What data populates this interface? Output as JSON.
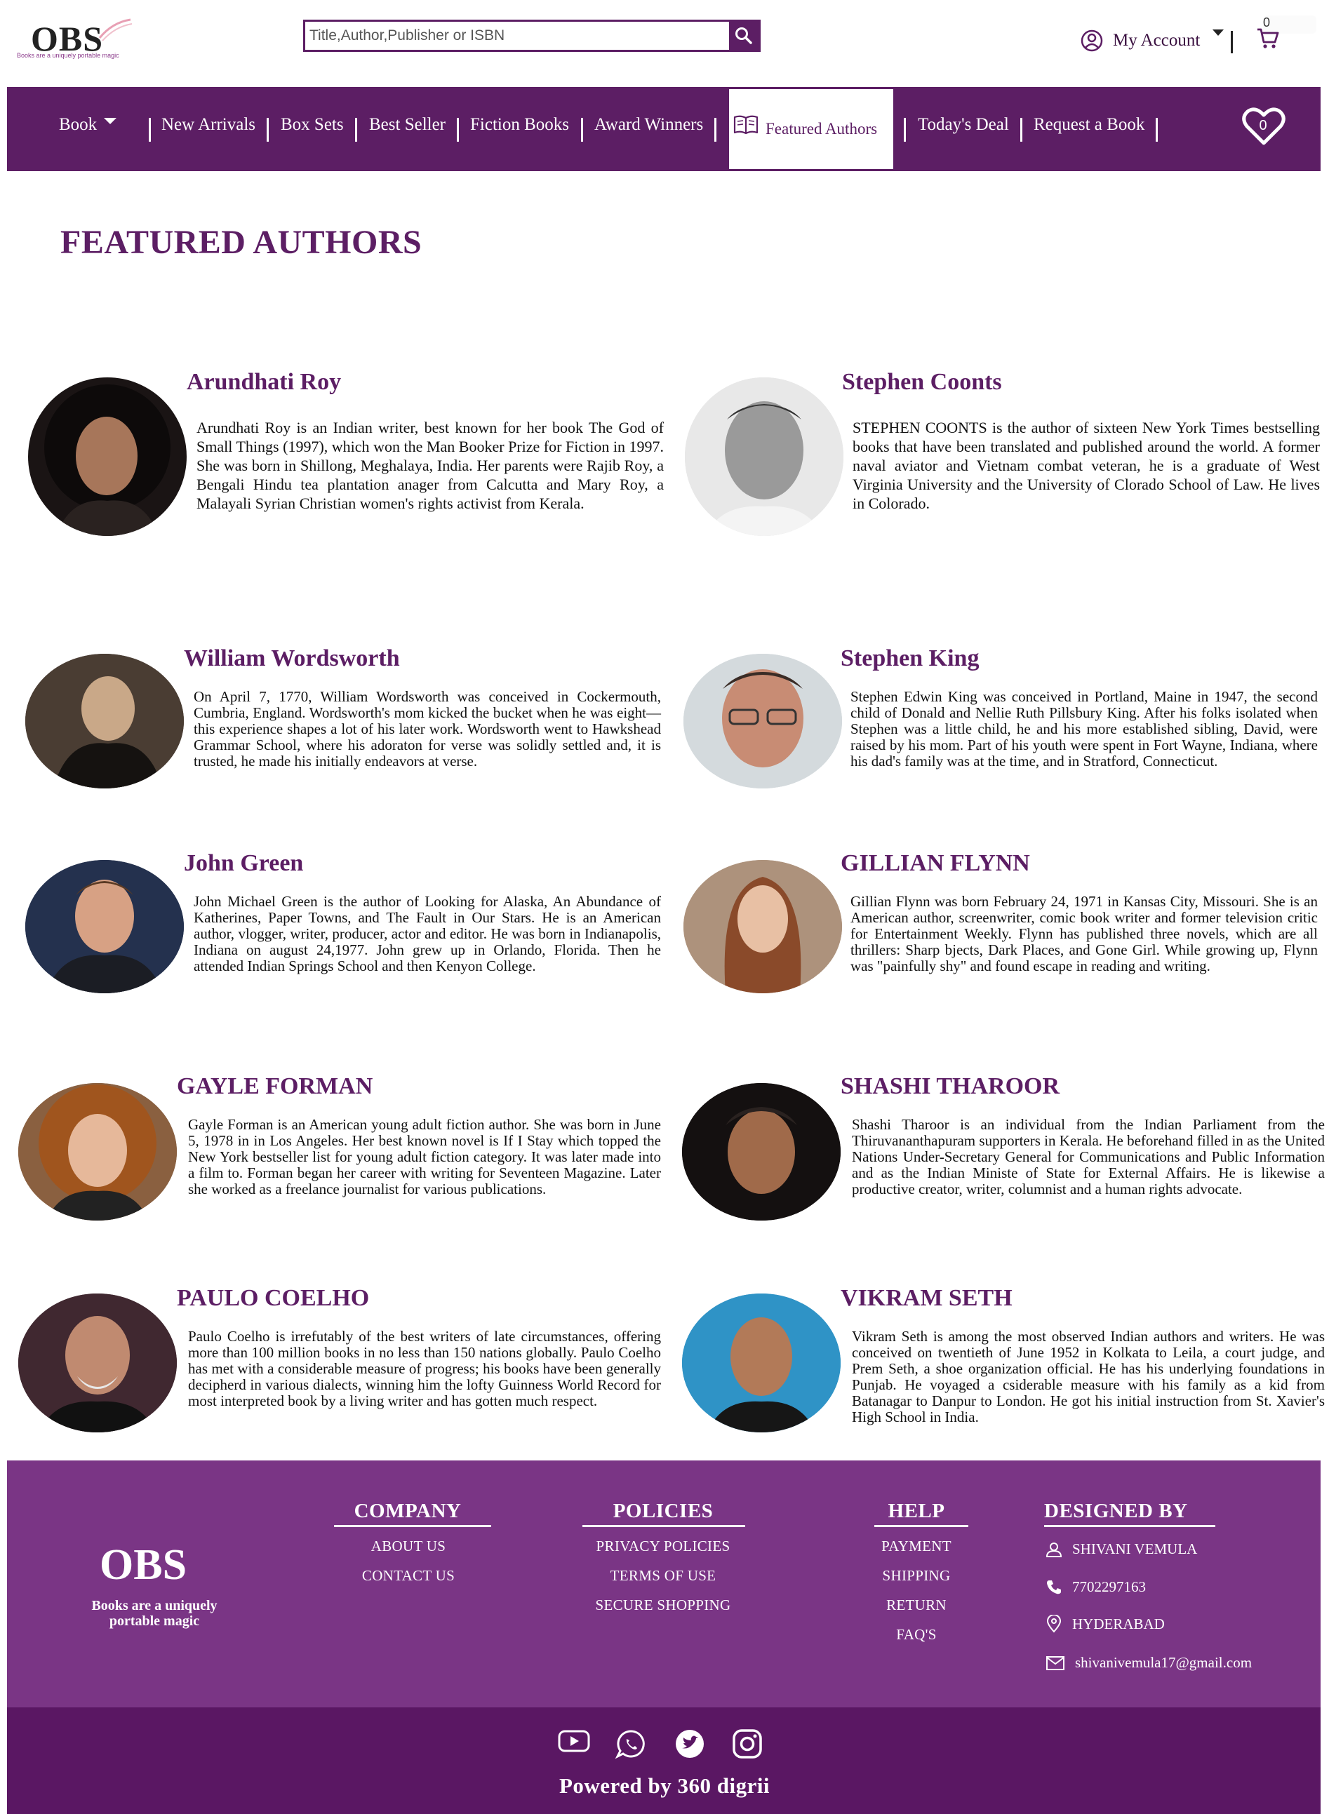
{
  "header": {
    "logo_text": "OBS",
    "logo_tagline": "Books are a uniquely portable magic",
    "search": {
      "placeholder": "Title,Author,Publisher or ISBN"
    },
    "account_label": "My Account",
    "cart_count": "0"
  },
  "nav": {
    "items": [
      "Book",
      "New Arrivals",
      "Box Sets",
      "Best Seller",
      "Fiction Books",
      "Award Winners",
      "Featured Authors",
      "Today's Deal",
      "Request a Book"
    ],
    "active": "Featured Authors",
    "wishlist_count": "0"
  },
  "page": {
    "title": "FEATURED AUTHORS"
  },
  "authors": [
    {
      "name": "Arundhati Roy",
      "bio": "Arundhati Roy is an Indian writer, best known for her book The God of Small Things (1997), which won the Man Booker Prize for Fiction in 1997. She was born in Shillong, Meghalaya, India. Her parents were Rajib Roy, a Bengali Hindu tea plantation anager from Calcutta and Mary Roy, a Malayali Syrian Christian women's rights activist from Kerala."
    },
    {
      "name": "Stephen Coonts",
      "bio": "STEPHEN COONTS is the author of sixteen New York Times bestselling books that have been translated and published around the world. A former naval aviator and Vietnam combat veteran, he is a graduate of West Virginia University and the University of Clorado School of Law. He lives in Colorado."
    },
    {
      "name": "William Wordsworth",
      "bio": "On April 7, 1770, William Wordsworth was conceived in Cockermouth, Cumbria, England. Wordsworth's mom kicked the bucket when he was eight—this experience shapes a lot of his later work. Wordsworth went to Hawkshead Grammar School, where his adoraton for verse was solidly settled and, it is trusted, he made his initially endeavors at verse."
    },
    {
      "name": "Stephen King",
      "bio": "Stephen Edwin King was conceived in Portland, Maine in 1947, the second child of Donald and Nellie Ruth Pillsbury King. After his folks isolated when Stephen was a little child, he and his more established sibling, David, were raised by his mom. Part of his youth were spent in Fort Wayne, Indiana, where his dad's family was at the time, and in Stratford, Connecticut."
    },
    {
      "name": "John Green",
      "bio": "John Michael Green is the author of Looking for Alaska, An Abundance of Katherines, Paper Towns, and The Fault in Our Stars. He is an American author, vlogger, writer, producer, actor and editor. He was born in Indianapolis, Indiana on august 24,1977. John grew up in Orlando, Florida. Then he attended Indian Springs School and then Kenyon College."
    },
    {
      "name": "GILLIAN FLYNN",
      "bio": "Gillian Flynn was born February 24, 1971 in Kansas City, Missouri. She is an American author, screenwriter, comic book writer and former television critic for Entertainment Weekly. Flynn has published three novels, which are all thrillers: Sharp bjects, Dark Places, and Gone Girl. While growing up, Flynn was \"painfully shy\" and found escape in reading and writing."
    },
    {
      "name": "GAYLE FORMAN",
      "bio": "Gayle Forman is an American young adult fiction author. She was born in June 5, 1978 in in Los Angeles. Her best known novel is If I Stay which topped the New York bestseller list for young adult fiction category. It was later made into a film to. Forman began her career with writing for Seventeen Magazine. Later she worked as a freelance journalist for various publications."
    },
    {
      "name": "SHASHI THAROOR",
      "bio": "Shashi Tharoor is an individual from the Indian Parliament from the Thiruvananthapuram supporters in Kerala. He beforehand filled in as the United Nations Under-Secretary General for Communications and Public Information and as the Indian Ministe of State for External Affairs. He is likewise a productive creator, writer, columnist and a human rights advocate."
    },
    {
      "name": "PAULO COELHO",
      "bio": "Paulo Coelho is irrefutably of the best writers of late circumstances, offering more than 100 million books in no less than 150 nations globally. Paulo Coelho has met with a considerable measure of progress; his books have been generally decipherd in various dialects, winning him the lofty Guinness World Record for most interpreted book by a living writer and has gotten much respect."
    },
    {
      "name": "VIKRAM SETH",
      "bio": "Vikram Seth is among the most observed Indian authors and writers. He was conceived on twentieth of June 1952 in Kolkata to Leila, a court judge, and Prem Seth, a shoe organization official. He has his underlying foundations in Punjab. He voyaged a csiderable measure with his family as a kid from Batanagar to Danpur to London. He got his initial instruction from St. Xavier's High School in India."
    }
  ],
  "footer": {
    "logo_text": "OBS",
    "tagline": "Books are a uniquely portable magic",
    "company": {
      "heading": "COMPANY",
      "links": [
        "ABOUT US",
        "CONTACT US"
      ]
    },
    "policies": {
      "heading": "POLICIES",
      "links": [
        "PRIVACY POLICIES",
        "TERMS OF USE",
        "SECURE SHOPPING"
      ]
    },
    "help": {
      "heading": "HELP",
      "links": [
        "PAYMENT",
        "SHIPPING",
        "RETURN",
        "FAQ'S"
      ]
    },
    "designed_by": {
      "heading": "DESIGNED BY",
      "name": "SHIVANI VEMULA",
      "phone": "7702297163",
      "location": "HYDERABAD",
      "email": "shivanivemula17@gmail.com"
    },
    "social_icons": [
      "youtube-icon",
      "whatsapp-icon",
      "twitter-icon",
      "instagram-icon"
    ],
    "powered_by": "Powered by 360 digrii"
  },
  "colors": {
    "brand": "#5c1e64",
    "footer": "#7a3585",
    "footer_bottom": "#5a1763"
  }
}
